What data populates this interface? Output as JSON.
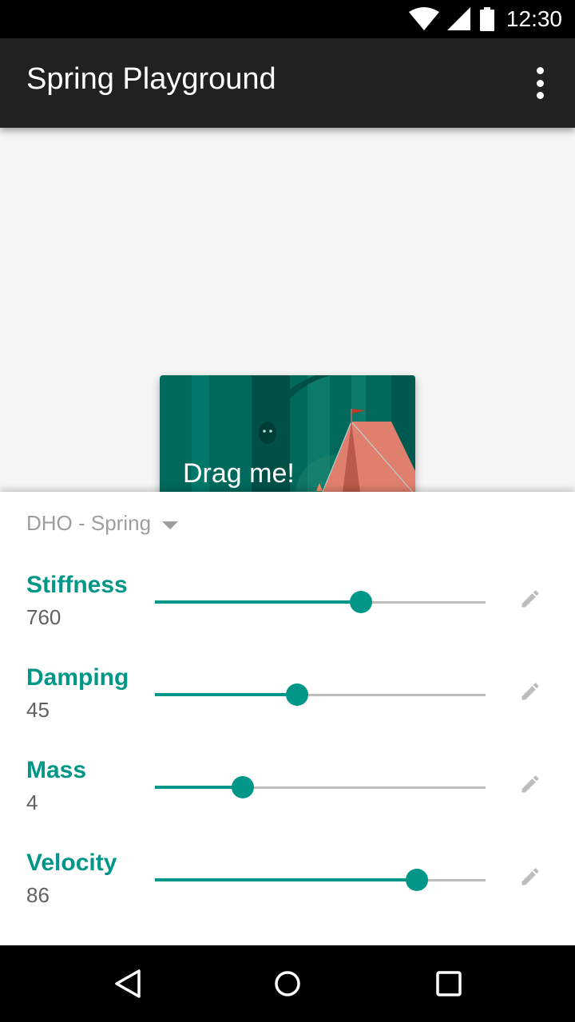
{
  "status_bar": {
    "time": "12:30",
    "icons": [
      "wifi-icon",
      "cell-signal-icon",
      "battery-icon"
    ]
  },
  "app_bar": {
    "title": "Spring Playground",
    "menu_icon": "more-vert-icon"
  },
  "canvas": {
    "card_label": "Drag me!"
  },
  "panel": {
    "spring_type": "DHO - Spring",
    "parameters": [
      {
        "name": "Stiffness",
        "value": "760",
        "slider_fraction": 0.623
      },
      {
        "name": "Damping",
        "value": "45",
        "slider_fraction": 0.43
      },
      {
        "name": "Mass",
        "value": "4",
        "slider_fraction": 0.266
      },
      {
        "name": "Velocity",
        "value": "86",
        "slider_fraction": 0.792
      }
    ]
  },
  "nav_bar": {
    "buttons": [
      "back-icon",
      "home-icon",
      "recents-icon"
    ]
  },
  "colors": {
    "accent": "#009688",
    "app_bar": "#212121",
    "track": "#bdbdbd"
  }
}
